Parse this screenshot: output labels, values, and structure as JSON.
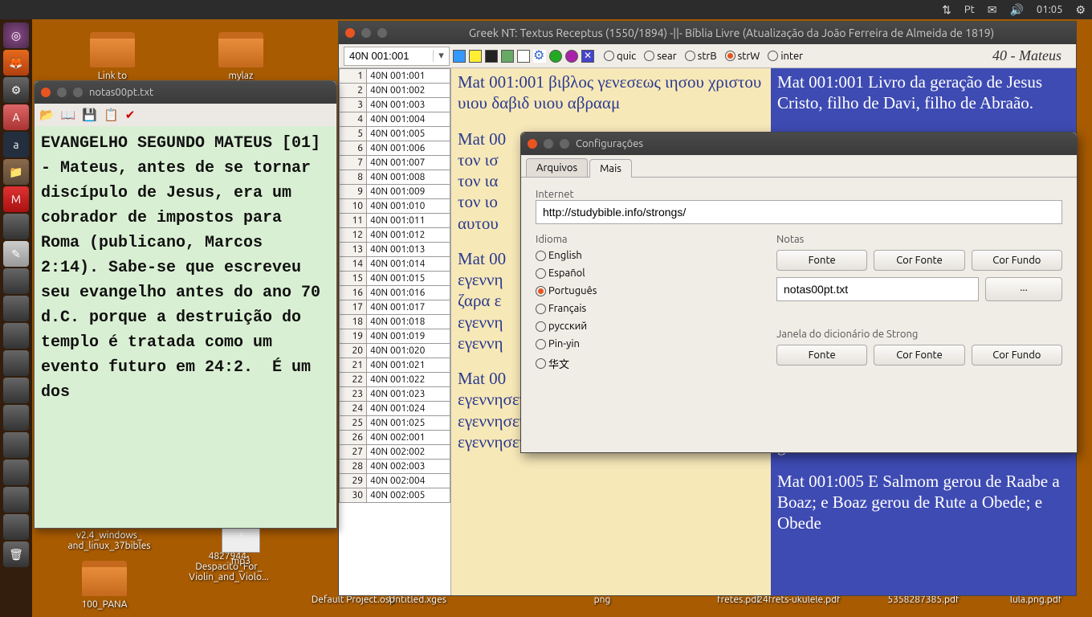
{
  "topbar": {
    "lang_indicator": "Pt",
    "clock": "01:05"
  },
  "desktop": {
    "link_to": "Link to",
    "mylaz": "mylaz",
    "v24": "v2.4_windows_\nand_linux_37bibles",
    "pana": "100_PANA",
    "despacito": "4827944-\nDespacito_For_\nViolin_and_Violo...",
    "mp3": "mp3",
    "default_project": "Default Project.osp",
    "untitled": "Untitled.xges",
    "png": "png",
    "fretes": "fretes.pdf",
    "frets": "24frets-ukulele.pdf",
    "num": "5358287385.pdf",
    "lula": "lula.png.pdf"
  },
  "notes": {
    "title": "notas00pt.txt",
    "body": "EVANGELHO SEGUNDO MATEUS [01] - Mateus, antes de se tornar discípulo de Jesus, era um cobrador de impostos para Roma (publicano, Marcos 2:14). Sabe-se que escreveu seu evangelho antes do ano 70 d.C. porque a destruição do templo é tratada como um evento futuro em 24:2.  É um dos"
  },
  "main": {
    "title": "Greek NT: Textus Receptus (1550/1894)  -||-  Bíblia Livre (Atualização da João Ferreira de Almeida de 1819)",
    "ref_input": "40N 001:001",
    "radios": [
      "quic",
      "sear",
      "strB",
      "strW",
      "inter"
    ],
    "radio_selected": "strW",
    "chapter": "40 - Mateus",
    "index_rows": [
      [
        "1",
        "40N 001:001"
      ],
      [
        "2",
        "40N 001:002"
      ],
      [
        "3",
        "40N 001:003"
      ],
      [
        "4",
        "40N 001:004"
      ],
      [
        "5",
        "40N 001:005"
      ],
      [
        "6",
        "40N 001:006"
      ],
      [
        "7",
        "40N 001:007"
      ],
      [
        "8",
        "40N 001:008"
      ],
      [
        "9",
        "40N 001:009"
      ],
      [
        "10",
        "40N 001:010"
      ],
      [
        "11",
        "40N 001:011"
      ],
      [
        "12",
        "40N 001:012"
      ],
      [
        "13",
        "40N 001:013"
      ],
      [
        "14",
        "40N 001:014"
      ],
      [
        "15",
        "40N 001:015"
      ],
      [
        "16",
        "40N 001:016"
      ],
      [
        "17",
        "40N 001:017"
      ],
      [
        "18",
        "40N 001:018"
      ],
      [
        "19",
        "40N 001:019"
      ],
      [
        "20",
        "40N 001:020"
      ],
      [
        "21",
        "40N 001:021"
      ],
      [
        "22",
        "40N 001:022"
      ],
      [
        "23",
        "40N 001:023"
      ],
      [
        "24",
        "40N 001:024"
      ],
      [
        "25",
        "40N 001:025"
      ],
      [
        "26",
        "40N 002:001"
      ],
      [
        "27",
        "40N 002:002"
      ],
      [
        "28",
        "40N 002:003"
      ],
      [
        "29",
        "40N 002:004"
      ],
      [
        "30",
        "40N 002:005"
      ]
    ],
    "greek": {
      "v1": "Mat 001:001 βιβλος γενεσεως ιησου χριστου υιου δαβιδ υιου αβρααμ",
      "v2": "Mat 00\nτον ισ\nτον ια\nτον ιο\nαυτου",
      "v3": "Mat 00\nεγεννη\nζαρα ε\nεγεννη\nεγεννη",
      "v4": "Mat 00\nεγεννησεν τον αμιναδαβ αμιναδαβ δε εγεννησεν τον ναασσων ναασσων δε εγεννησεν τον σαλμων"
    },
    "pt": {
      "v1": "Mat 001:001 Livro da geração de Jesus Cristo, filho de Davi, filho de Abraão.",
      "v4b": "gerou a Salmom.",
      "v5": "Mat 001:005 E Salmom gerou de Raabe a Boaz; e Boaz gerou de Rute a Obede; e Obede"
    }
  },
  "settings": {
    "title": "Configurações",
    "tabs": {
      "arquivos": "Arquivos",
      "mais": "Mais"
    },
    "internet_label": "Internet",
    "internet_value": "http://studybible.info/strongs/",
    "idioma_label": "Idioma",
    "languages": [
      "English",
      "Español",
      "Português",
      "Français",
      "русский",
      "Pin-yin",
      "华文"
    ],
    "language_selected": "Português",
    "notas_label": "Notas",
    "strong_label": "Janela do dicionário de Strong",
    "btn_fonte": "Fonte",
    "btn_cor_fonte": "Cor Fonte",
    "btn_cor_fundo": "Cor Fundo",
    "notes_file": "notas00pt.txt",
    "browse": "..."
  }
}
